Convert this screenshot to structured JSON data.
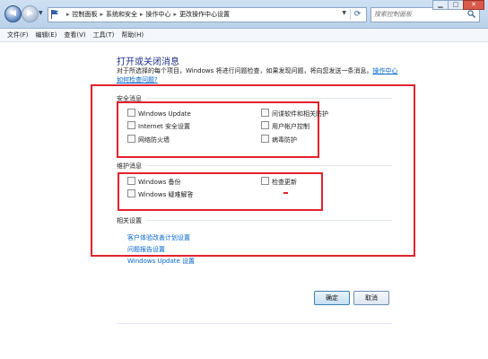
{
  "address": {
    "crumbs": [
      "控制面板",
      "系统和安全",
      "操作中心",
      "更改操作中心设置"
    ],
    "search_placeholder": "搜索控制面板"
  },
  "menu": [
    "文件(F)",
    "编辑(E)",
    "查看(V)",
    "工具(T)",
    "帮助(H)"
  ],
  "main": {
    "title": "打开或关闭消息",
    "description": "对于所选择的每个项目，Windows 将进行问题检查，如果发现问题，将向您发送一条消息。",
    "description_link": "操作中心如何检查问题?",
    "security": {
      "label": "安全消息",
      "items": [
        "Windows Update",
        "Internet 安全设置",
        "网络防火墙",
        "间谍软件和相关防护",
        "用户帐户控制",
        "病毒防护"
      ]
    },
    "maintenance": {
      "label": "维护消息",
      "items": [
        "Windows 备份",
        "Windows 疑难解答",
        "检查更新"
      ]
    },
    "related": {
      "label": "相关设置",
      "links": [
        "客户体验改善计划设置",
        "问题报告设置",
        "Windows Update 设置"
      ]
    }
  },
  "buttons": {
    "ok": "确定",
    "cancel": "取消"
  },
  "colors": {
    "highlight_frame": "#e2222d",
    "link": "#0066cc",
    "title": "#1e3287"
  },
  "icons": [
    "back-icon",
    "forward-icon",
    "flag-icon",
    "refresh-icon",
    "search-icon",
    "minimize-icon",
    "maximize-icon",
    "close-icon"
  ]
}
